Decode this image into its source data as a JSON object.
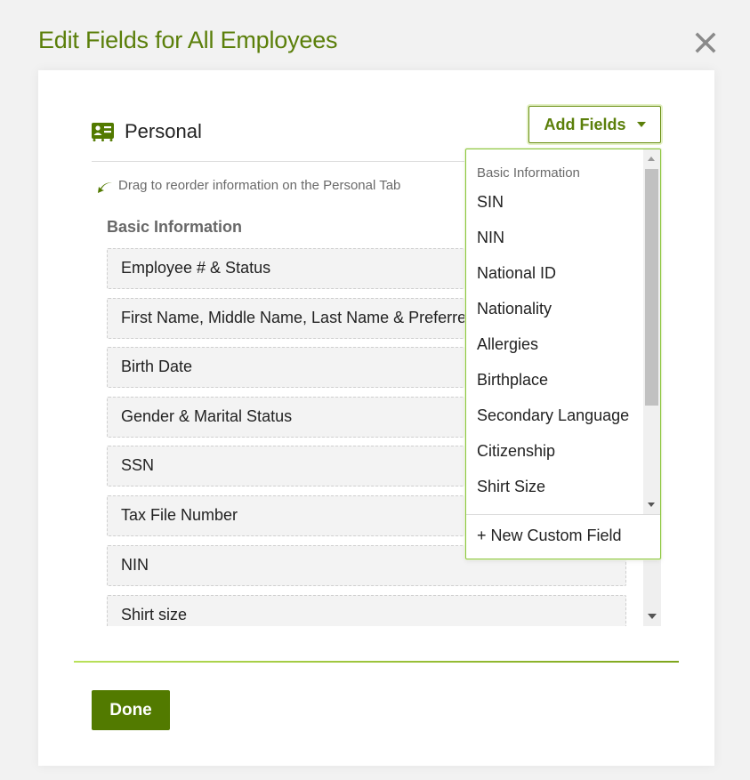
{
  "modal": {
    "title": "Edit Fields for All Employees",
    "close_icon": "close-icon"
  },
  "colors": {
    "brand_green": "#5b7f0a",
    "button_green": "#527a00",
    "accent_lime": "#8cc63f"
  },
  "section": {
    "icon": "id-card-icon",
    "title": "Personal",
    "drag_hint": "Drag to reorder information on the Personal Tab",
    "drag_icon": "curved-arrow-icon",
    "group_label": "Basic Information",
    "fields": [
      {
        "label": "Employee # & Status"
      },
      {
        "label": "First Name, Middle Name, Last Name & Preferred Name"
      },
      {
        "label": "Birth Date"
      },
      {
        "label": "Gender & Marital Status"
      },
      {
        "label": "SSN"
      },
      {
        "label": "Tax File Number"
      },
      {
        "label": "NIN"
      },
      {
        "label": "Shirt size"
      }
    ]
  },
  "add_fields": {
    "label": "Add Fields",
    "dropdown": {
      "group_label": "Basic Information",
      "items": [
        "SIN",
        "NIN",
        "National ID",
        "Nationality",
        "Allergies",
        "Birthplace",
        "Secondary Language",
        "Citizenship",
        "Shirt Size"
      ],
      "footer_label": "+ New Custom Field"
    }
  },
  "footer": {
    "done_label": "Done"
  }
}
